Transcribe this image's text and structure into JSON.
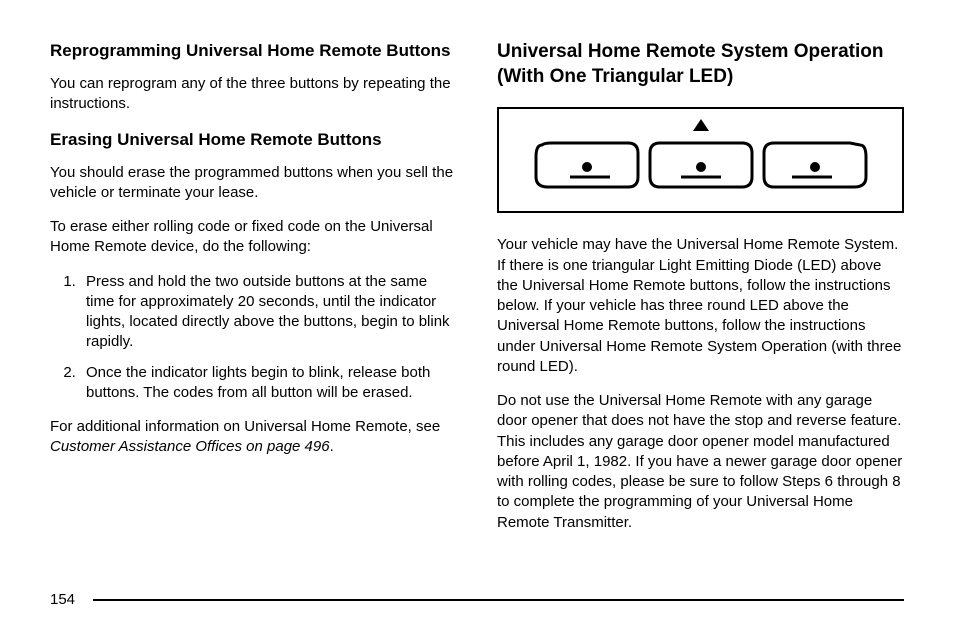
{
  "left": {
    "heading1": "Reprogramming Universal Home Remote Buttons",
    "p1": "You can reprogram any of the three buttons by repeating the instructions.",
    "heading2": "Erasing Universal Home Remote Buttons",
    "p2": "You should erase the programmed buttons when you sell the vehicle or terminate your lease.",
    "p3": "To erase either rolling code or fixed code on the Universal Home Remote device, do the following:",
    "li1": "Press and hold the two outside buttons at the same time for approximately 20 seconds, until the indicator lights, located directly above the buttons, begin to blink rapidly.",
    "li2": "Once the indicator lights begin to blink, release both buttons. The codes from all button will be erased.",
    "p4a": "For additional information on Universal Home Remote, see ",
    "p4b": "Customer Assistance Offices on page 496",
    "p4c": "."
  },
  "right": {
    "heading1": "Universal Home Remote System Operation (With One Triangular LED)",
    "p1": "Your vehicle may have the Universal Home Remote System. If there is one triangular Light Emitting Diode (LED) above the Universal Home Remote buttons, follow the instructions below. If your vehicle has three round LED above the Universal Home Remote buttons, follow the instructions under Universal Home Remote System Operation (with three round LED).",
    "p2": "Do not use the Universal Home Remote with any garage door opener that does not have the stop and reverse feature. This includes any garage door opener model manufactured before April 1, 1982. If you have a newer garage door opener with rolling codes, please be sure to follow Steps 6 through 8 to complete the programming of your Universal Home Remote Transmitter."
  },
  "footer": {
    "page_number": "154"
  }
}
